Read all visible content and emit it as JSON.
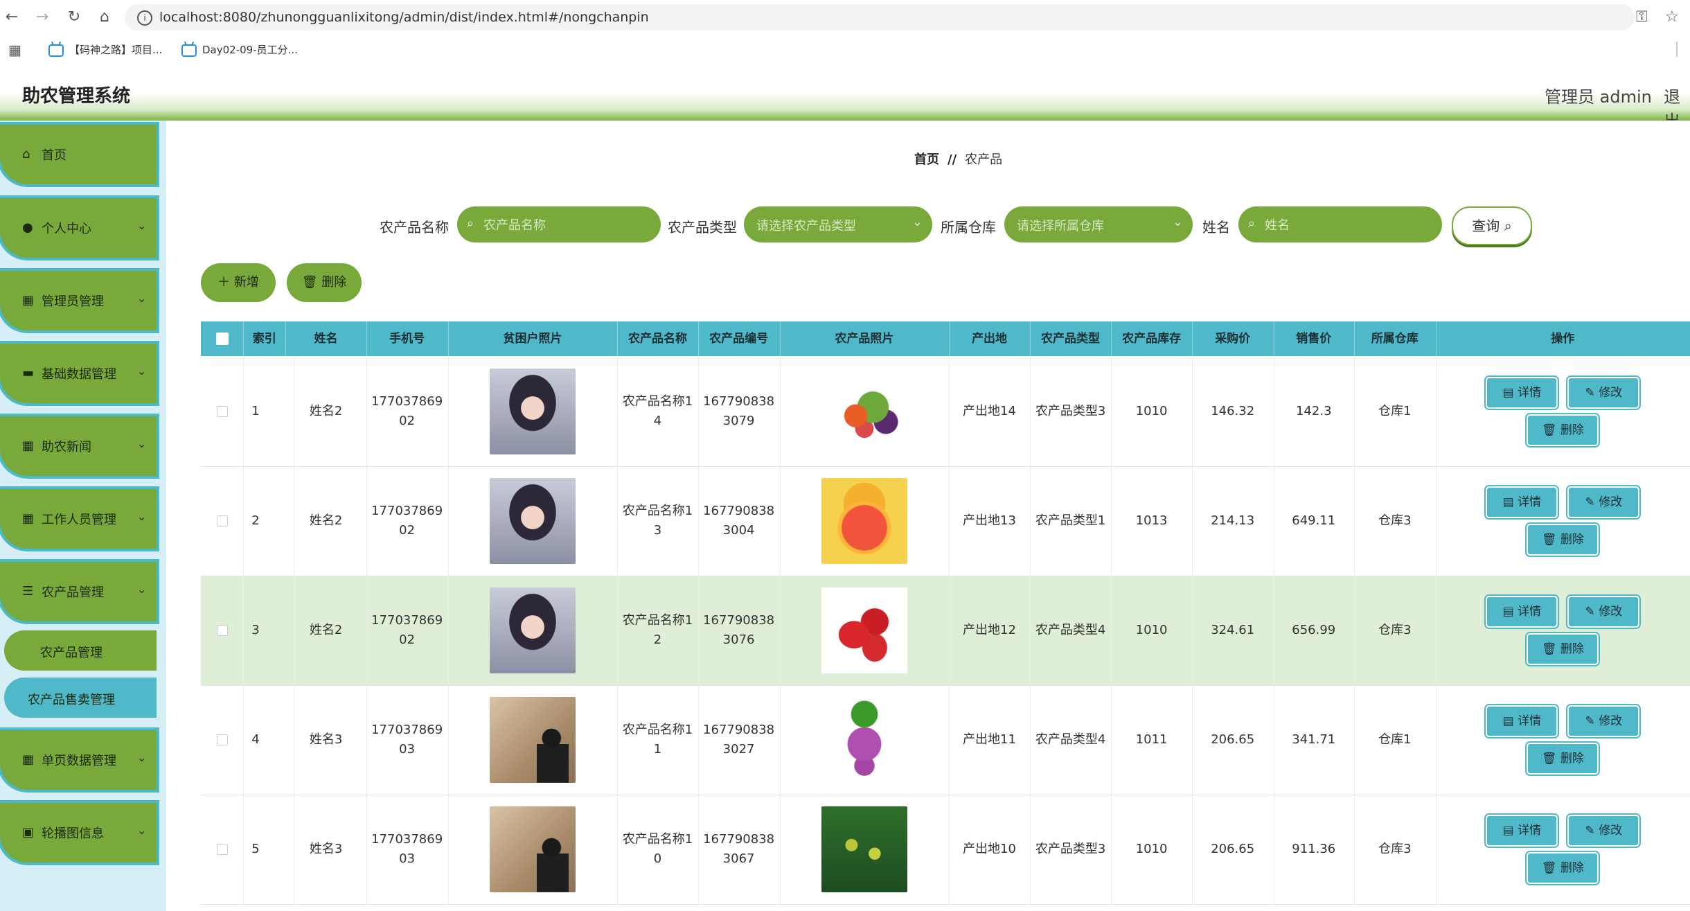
{
  "browser": {
    "url": "localhost:8080/zhunongguanlixitong/admin/dist/index.html#/nongchanpin",
    "bookmarks": [
      "【码神之路】项目...",
      "Day02-09-员工分..."
    ]
  },
  "header": {
    "title": "助农管理系统",
    "user": "管理员 admin",
    "logout": "退出"
  },
  "sidebar": {
    "items": [
      {
        "label": "首页",
        "icon": "home-icon"
      },
      {
        "label": "个人中心",
        "icon": "user-icon"
      },
      {
        "label": "管理员管理",
        "icon": "grid-icon"
      },
      {
        "label": "基础数据管理",
        "icon": "database-icon"
      },
      {
        "label": "助农新闻",
        "icon": "grid-icon"
      },
      {
        "label": "工作人员管理",
        "icon": "grid-icon"
      },
      {
        "label": "农产品管理",
        "icon": "sliders-icon"
      },
      {
        "label": "单页数据管理",
        "icon": "grid-icon"
      },
      {
        "label": "轮播图信息",
        "icon": "image-icon"
      }
    ],
    "sub_items": [
      "农产品管理",
      "农产品售卖管理"
    ]
  },
  "breadcrumb": {
    "home": "首页",
    "separator": "//",
    "current": "农产品"
  },
  "filters": {
    "name_label": "农产品名称",
    "name_placeholder": "农产品名称",
    "type_label": "农产品类型",
    "type_placeholder": "请选择农产品类型",
    "warehouse_label": "所属仓库",
    "warehouse_placeholder": "请选择所属仓库",
    "person_label": "姓名",
    "person_placeholder": "姓名",
    "query": "查询"
  },
  "actions": {
    "add": "＋ 新增",
    "delete": "删除"
  },
  "table": {
    "columns": [
      "索引",
      "姓名",
      "手机号",
      "贫困户照片",
      "农产品名称",
      "农产品编号",
      "农产品照片",
      "产出地",
      "农产品类型",
      "农产品库存",
      "采购价",
      "销售价",
      "所属仓库",
      "操作"
    ],
    "rows": [
      {
        "index": "1",
        "name": "姓名2",
        "phone": "17703786902",
        "person_photo": "girl",
        "product": "农产品名称14",
        "code": "1677908383079",
        "product_photo": "vegetables",
        "origin": "产出地14",
        "type": "农产品类型3",
        "stock": "1010",
        "buy": "146.32",
        "sell": "142.3",
        "warehouse": "仓库1"
      },
      {
        "index": "2",
        "name": "姓名2",
        "phone": "17703786902",
        "person_photo": "girl",
        "product": "农产品名称13",
        "code": "1677908383004",
        "product_photo": "grapefruit",
        "origin": "产出地13",
        "type": "农产品类型1",
        "stock": "1013",
        "buy": "214.13",
        "sell": "649.11",
        "warehouse": "仓库3"
      },
      {
        "index": "3",
        "name": "姓名2",
        "phone": "17703786902",
        "person_photo": "girl",
        "product": "农产品名称12",
        "code": "1677908383076",
        "product_photo": "strawberry",
        "origin": "产出地12",
        "type": "农产品类型4",
        "stock": "1010",
        "buy": "324.61",
        "sell": "656.99",
        "warehouse": "仓库3"
      },
      {
        "index": "4",
        "name": "姓名3",
        "phone": "17703786903",
        "person_photo": "man",
        "product": "农产品名称11",
        "code": "1677908383027",
        "product_photo": "grape",
        "origin": "产出地11",
        "type": "农产品类型4",
        "stock": "1011",
        "buy": "206.65",
        "sell": "341.71",
        "warehouse": "仓库1"
      },
      {
        "index": "5",
        "name": "姓名3",
        "phone": "17703786903",
        "person_photo": "man",
        "product": "农产品名称10",
        "code": "1677908383067",
        "product_photo": "tree",
        "origin": "产出地10",
        "type": "农产品类型3",
        "stock": "1010",
        "buy": "206.65",
        "sell": "911.36",
        "warehouse": "仓库3"
      }
    ],
    "op_labels": {
      "detail": "详情",
      "edit": "修改",
      "delete": "删除"
    }
  },
  "colors": {
    "accent_green": "#78a93a",
    "accent_teal": "#4fb9c9",
    "highlight_row": "#dfeed6"
  }
}
